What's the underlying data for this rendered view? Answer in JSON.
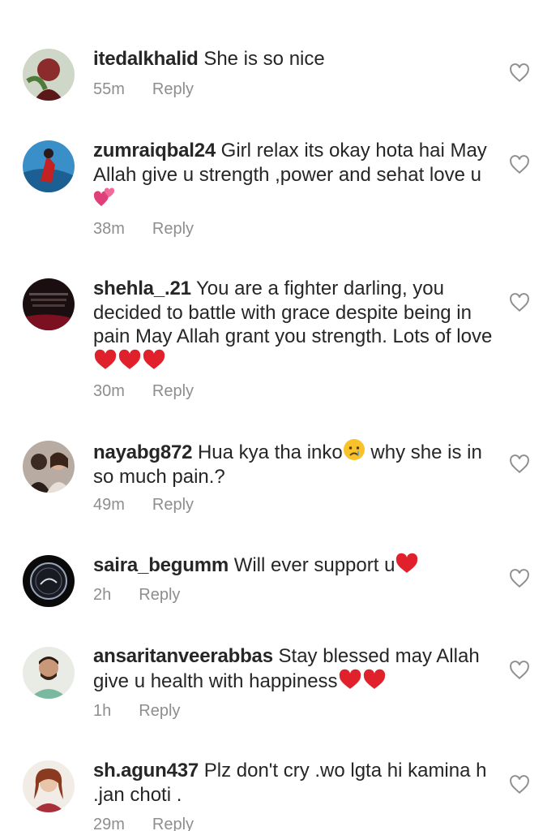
{
  "comments": [
    {
      "username": "itedalkhalid",
      "text": "She is so nice",
      "time": "55m",
      "reply_label": "Reply",
      "emoji": []
    },
    {
      "username": "zumraiqbal24",
      "text": "Girl relax its okay hota hai May Allah give u strength ,power and sehat love u",
      "time": "38m",
      "reply_label": "Reply",
      "emoji": [
        "two-hearts"
      ]
    },
    {
      "username": "shehla_.21",
      "text": "You are a fighter darling, you decided to battle with grace despite being in pain May Allah grant you strength. Lots of love",
      "time": "30m",
      "reply_label": "Reply",
      "emoji": [
        "red-heart",
        "red-heart",
        "red-heart"
      ]
    },
    {
      "username": "nayabg872",
      "text_before": "Hua kya tha inko",
      "text_after": " why she is in so much pain.?",
      "time": "49m",
      "reply_label": "Reply",
      "emoji": [
        "crying-face"
      ]
    },
    {
      "username": "saira_begumm",
      "text": "Will ever support u",
      "time": "2h",
      "reply_label": "Reply",
      "emoji": [
        "red-heart"
      ]
    },
    {
      "username": "ansaritanveerabbas",
      "text": "Stay blessed may Allah give u health with happiness",
      "time": "1h",
      "reply_label": "Reply",
      "emoji": [
        "red-heart",
        "red-heart"
      ]
    },
    {
      "username": "sh.agun437",
      "text": "Plz don't cry .wo lgta hi kamina h .jan choti .",
      "time": "29m",
      "reply_label": "Reply",
      "emoji": []
    }
  ],
  "icons": {
    "like": "heart-outline-icon"
  },
  "colors": {
    "text": "#262626",
    "meta": "#8e8e8e",
    "heart_outline": "#8e8e8e",
    "red_heart": "#e0202a",
    "pink_heart": "#e0407a"
  }
}
